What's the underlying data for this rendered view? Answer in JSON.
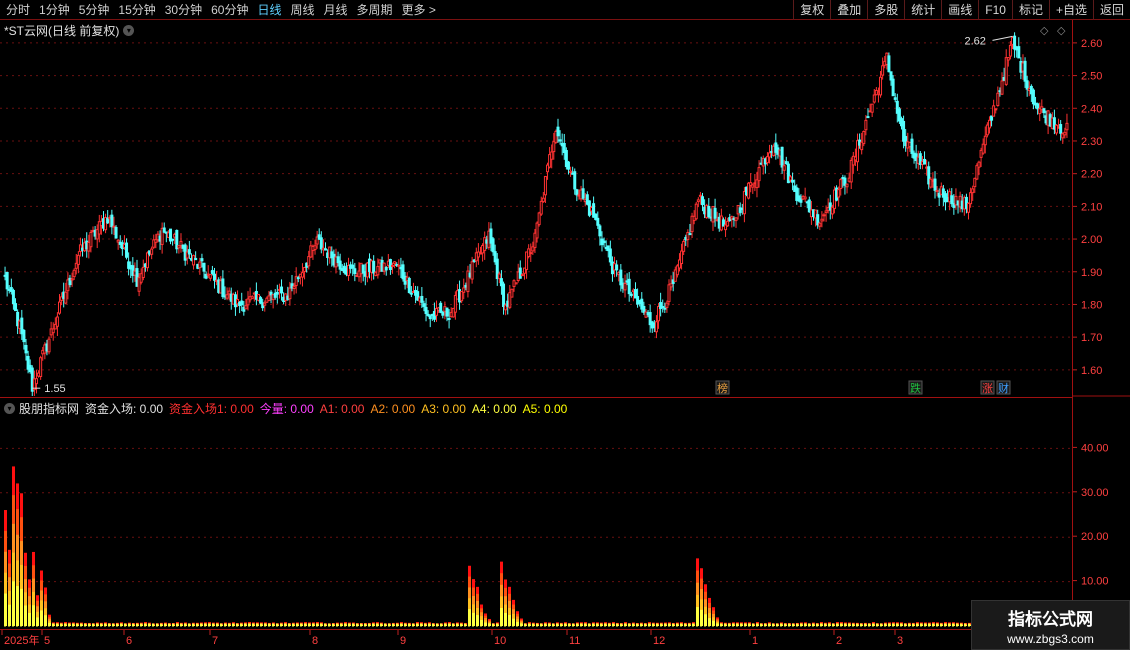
{
  "toolbar": {
    "periods": [
      "分时",
      "1分钟",
      "5分钟",
      "15分钟",
      "30分钟",
      "60分钟",
      "日线",
      "周线",
      "月线",
      "多周期",
      "更多 >"
    ],
    "active_period": "日线",
    "tools": [
      "复权",
      "叠加",
      "多股",
      "统计",
      "画线",
      "F10",
      "标记",
      "+自选",
      "返回"
    ]
  },
  "main_pane": {
    "title": "*ST云网(日线 前复权)",
    "high_label": "2.62",
    "low_label": "1.55",
    "price_axis": [
      "2.60",
      "2.50",
      "2.40",
      "2.30",
      "2.20",
      "2.10",
      "2.00",
      "1.90",
      "1.80",
      "1.70",
      "1.60"
    ],
    "markers": [
      {
        "text": "榜",
        "color": "#e8a040"
      },
      {
        "text": "跌",
        "color": "#20c040"
      },
      {
        "text": "涨",
        "color": "#ff4040"
      },
      {
        "text": "财",
        "color": "#40a0ff"
      }
    ]
  },
  "indicator_pane": {
    "name": "股朋指标网",
    "items": [
      {
        "label": "资金入场: 0.00",
        "color": "#e0e0e0"
      },
      {
        "label": "资金入场1: 0.00",
        "color": "#ff3030"
      },
      {
        "label": "今量: 0.00",
        "color": "#ff40ff"
      },
      {
        "label": "A1: 0.00",
        "color": "#ff4040"
      },
      {
        "label": "A2: 0.00",
        "color": "#ff9020"
      },
      {
        "label": "A3: 0.00",
        "color": "#ffc020"
      },
      {
        "label": "A4: 0.00",
        "color": "#ffff40"
      },
      {
        "label": "A5: 0.00",
        "color": "#ffff00"
      }
    ],
    "value_axis": [
      "40.00",
      "30.00",
      "20.00",
      "10.00"
    ]
  },
  "date_axis": [
    "2025年",
    "5",
    "6",
    "7",
    "8",
    "9",
    "10",
    "11",
    "12",
    "1",
    "2",
    "3"
  ],
  "watermark": {
    "line1": "指标公式网",
    "line2": "www.zbgs3.com"
  },
  "chart_data": {
    "type": "candlestick",
    "ylim": [
      1.52,
      2.67
    ],
    "high": 2.62,
    "low": 1.55,
    "candle_segments": [
      [
        1.9,
        1.73,
        8
      ],
      [
        1.73,
        1.55,
        6
      ],
      [
        1.55,
        1.95,
        22
      ],
      [
        1.95,
        2.07,
        14
      ],
      [
        2.07,
        1.88,
        14
      ],
      [
        1.88,
        2.03,
        12
      ],
      [
        2.03,
        1.8,
        36
      ],
      [
        1.8,
        1.83,
        24
      ],
      [
        1.83,
        1.99,
        14
      ],
      [
        1.99,
        1.9,
        16
      ],
      [
        1.9,
        1.92,
        22
      ],
      [
        1.92,
        1.76,
        16
      ],
      [
        1.76,
        1.78,
        10
      ],
      [
        1.78,
        2.01,
        18
      ],
      [
        2.01,
        1.79,
        8
      ],
      [
        1.79,
        2.0,
        14
      ],
      [
        2.0,
        2.35,
        10
      ],
      [
        2.35,
        2.18,
        8
      ],
      [
        2.18,
        2.07,
        10
      ],
      [
        2.07,
        1.9,
        10
      ],
      [
        1.9,
        1.74,
        18
      ],
      [
        1.74,
        1.86,
        10
      ],
      [
        1.86,
        2.12,
        12
      ],
      [
        2.12,
        2.03,
        14
      ],
      [
        2.03,
        2.3,
        22
      ],
      [
        2.3,
        2.15,
        10
      ],
      [
        2.15,
        2.06,
        12
      ],
      [
        2.06,
        2.2,
        14
      ],
      [
        2.2,
        2.55,
        18
      ],
      [
        2.55,
        2.3,
        8
      ],
      [
        2.3,
        2.15,
        16
      ],
      [
        2.15,
        2.1,
        14
      ],
      [
        2.1,
        2.6,
        22
      ],
      [
        2.6,
        2.4,
        12
      ],
      [
        2.4,
        2.33,
        14
      ]
    ],
    "indicator_bursts": [
      {
        "x_frac": 0.01,
        "peak": 45
      },
      {
        "x_frac": 0.437,
        "peak": 16
      },
      {
        "x_frac": 0.468,
        "peak": 14.5
      },
      {
        "x_frac": 0.652,
        "peak": 18
      }
    ],
    "indicator_ylim": [
      0,
      50
    ]
  }
}
